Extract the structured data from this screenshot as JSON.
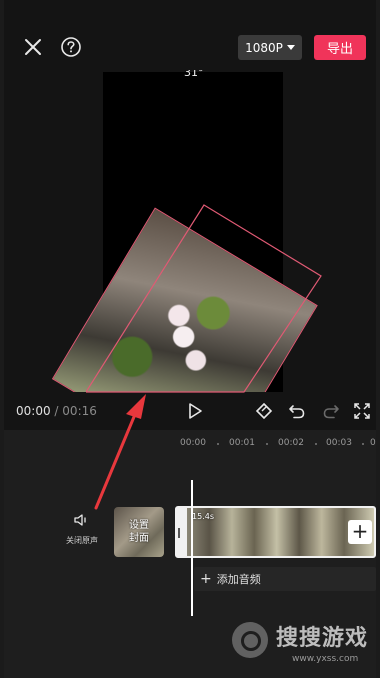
{
  "topbar": {
    "resolution": "1080P",
    "export_label": "导出"
  },
  "preview": {
    "rotation_label": "31°"
  },
  "playback": {
    "current_time": "00:00",
    "separator": "/",
    "total_time": "00:16"
  },
  "timeline": {
    "ruler": [
      "00:00",
      "00:01",
      "00:02",
      "00:03",
      "0"
    ],
    "mute_label": "关闭原声",
    "cover_label_line1": "设置",
    "cover_label_line2": "封面",
    "clip_duration": "15.4s",
    "add_clip_label": "+",
    "add_audio_icon": "+",
    "add_audio_label": "添加音频"
  },
  "watermark": {
    "title": "搜搜游戏",
    "url": "www.yxss.com"
  },
  "colors": {
    "accent": "#f0345a",
    "annotation": "#e8383d"
  }
}
